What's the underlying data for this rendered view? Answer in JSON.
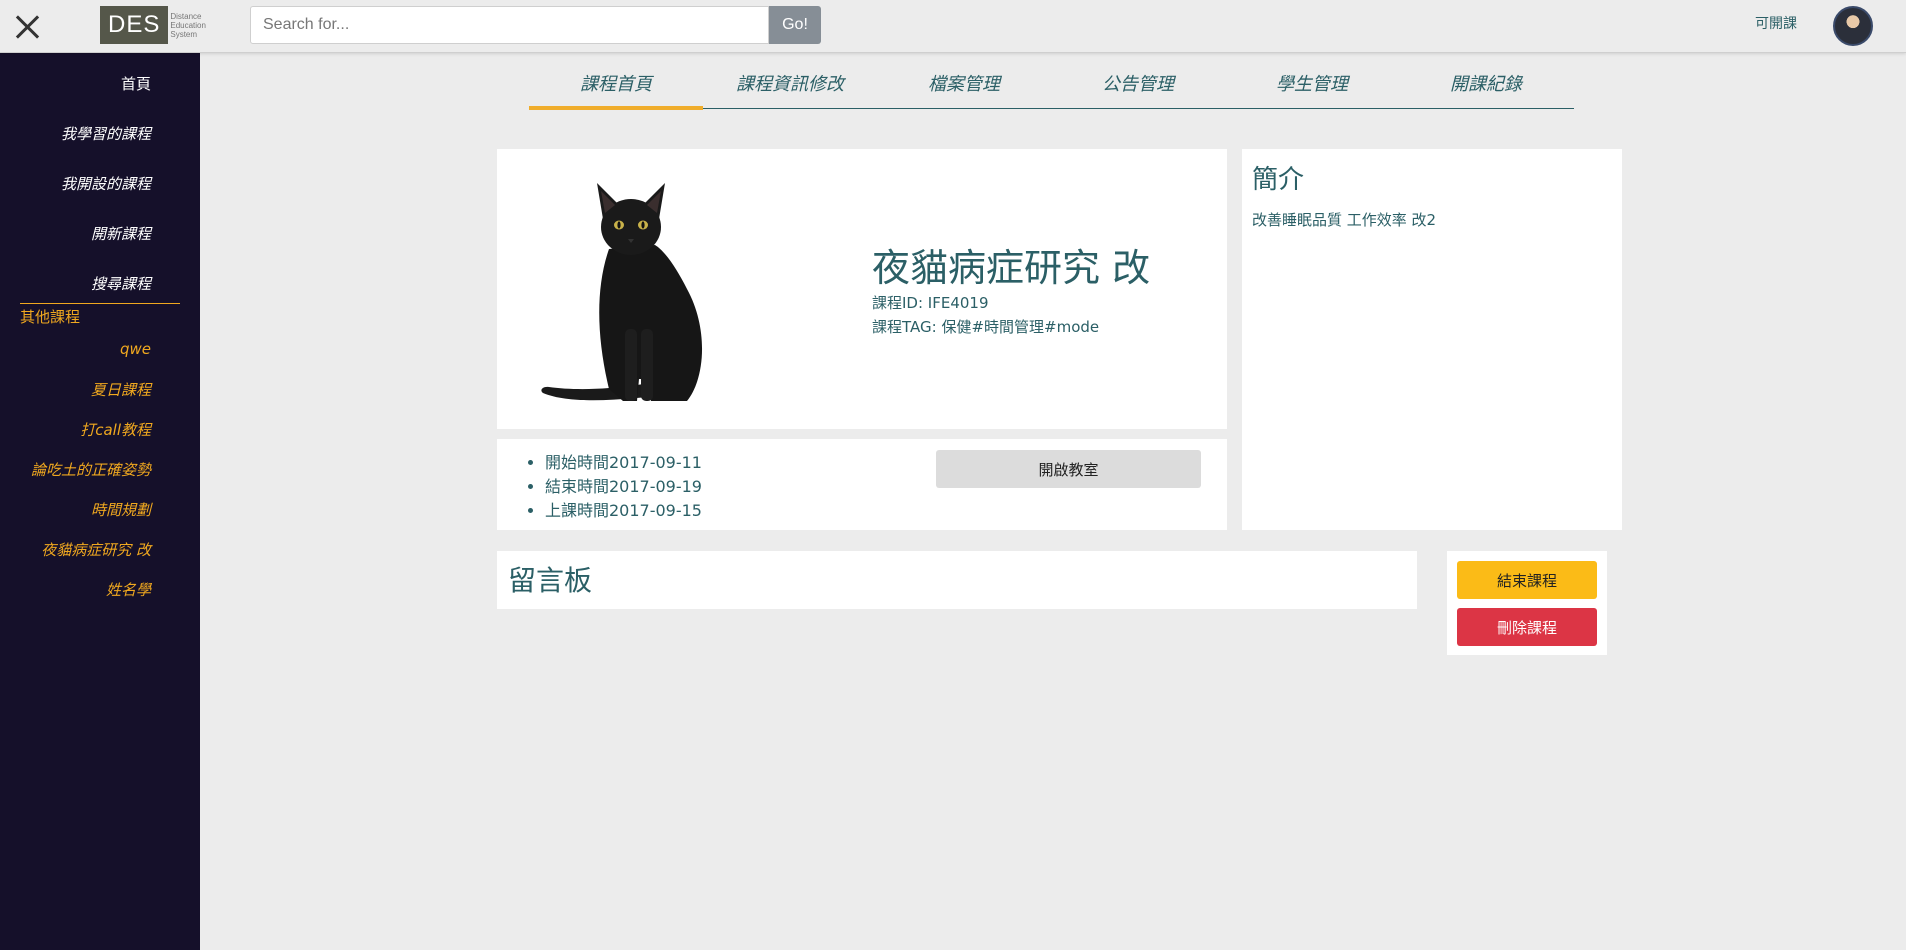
{
  "header": {
    "logo_text": "DES",
    "logo_sub": [
      "Distance",
      "Education",
      "System"
    ],
    "search_placeholder": "Search for...",
    "search_button": "Go!",
    "top_link": "可開課"
  },
  "sidebar": {
    "main": [
      "首頁",
      "我學習的課程",
      "我開設的課程",
      "開新課程",
      "搜尋課程"
    ],
    "other_heading": "其他課程",
    "other": [
      "qwe",
      "夏日課程",
      "打call教程",
      "論吃土的正確姿勢",
      "時間規劃",
      "夜貓病症研究 改",
      "姓名學"
    ]
  },
  "tabs": [
    "課程首頁",
    "課程資訊修改",
    "檔案管理",
    "公告管理",
    "學生管理",
    "開課紀錄"
  ],
  "course": {
    "title": "夜貓病症研究 改",
    "id_line": "課程ID: IFE4019",
    "tag_line": "課程TAG: 保健#時間管理#mode",
    "dates": [
      "開始時間2017-09-11",
      "結束時間2017-09-19",
      "上課時間2017-09-15"
    ],
    "open_room_button": "開啟教室"
  },
  "intro": {
    "title": "簡介",
    "text": "改善睡眠品質 工作效率 改2"
  },
  "board": {
    "title": "留言板"
  },
  "actions": {
    "end_button": "結束課程",
    "delete_button": "刪除課程"
  },
  "colors": {
    "sidebar_bg": "#15102a",
    "accent_orange": "#f0a81f",
    "text_teal": "#2b5f66",
    "end_yellow": "#fbbb17",
    "delete_red": "#dc3545"
  },
  "icons": [
    "close-icon",
    "avatar",
    "cat-image"
  ]
}
